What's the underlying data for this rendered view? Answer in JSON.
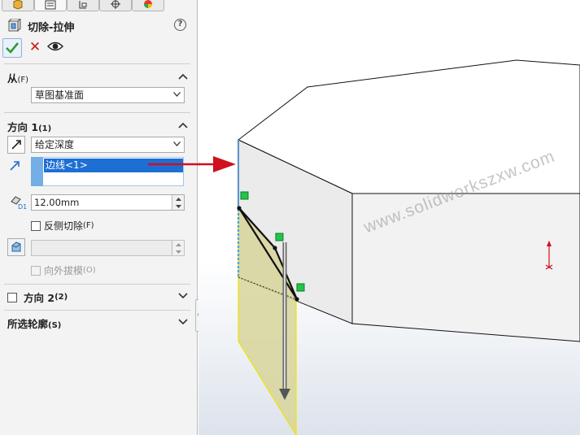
{
  "tabs": [
    {
      "name": "feature-manager",
      "icon": "feature-manager-icon"
    },
    {
      "name": "property-manager",
      "icon": "property-manager-icon"
    },
    {
      "name": "configuration-manager",
      "icon": "configuration-manager-icon"
    },
    {
      "name": "dimxpert-manager",
      "icon": "dimxpert-icon"
    },
    {
      "name": "display-manager",
      "icon": "appearance-icon"
    }
  ],
  "feature": {
    "title": "切除-拉伸",
    "help": "?",
    "cancel": "✕"
  },
  "from_group": {
    "title": "从",
    "hotkey": "(F)",
    "start_condition": "草图基准面"
  },
  "direction1": {
    "title": "方向 1",
    "hotkey": "(1)",
    "end_condition": "给定深度",
    "direction_reference": "边线<1>",
    "depth": "12.00mm",
    "flip_side_label": "反侧切除",
    "flip_side_hotkey": "(F)",
    "draft_value": "",
    "draft_outward_label": "向外拔模",
    "draft_outward_hotkey": "(O)"
  },
  "direction2": {
    "title": "方向 2",
    "hotkey": "(2)"
  },
  "selected_contours": {
    "title": "所选轮廓",
    "hotkey": "(S)"
  },
  "viewport": {
    "watermark": "www.solidworkszxw.com",
    "accent_red": "#d0101e",
    "preview_fill": "#d8d59b",
    "handle_green": "#22c54a"
  }
}
